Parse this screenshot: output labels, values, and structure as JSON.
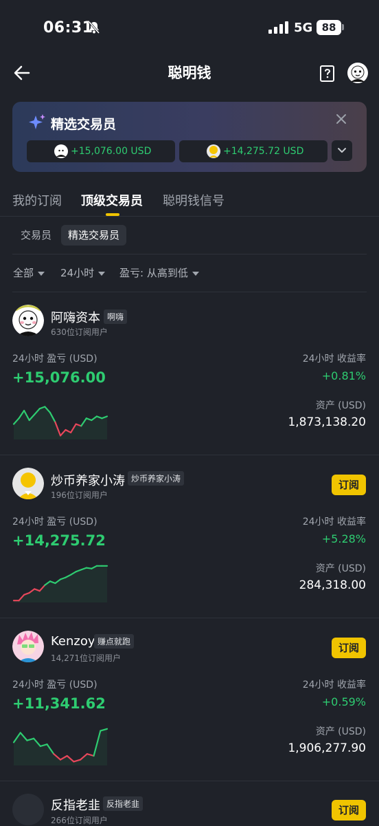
{
  "status_bar": {
    "time": "06:31",
    "network": "5G",
    "battery": "88"
  },
  "header": {
    "title": "聪明钱",
    "back_icon": "arrow-left-icon",
    "help_icon": "help-book-icon"
  },
  "banner": {
    "title": "精选交易员",
    "chips": [
      {
        "value": "+15,076.00 USD"
      },
      {
        "value": "+14,275.72 USD"
      }
    ]
  },
  "tabs": [
    "我的订阅",
    "顶级交易员",
    "聪明钱信号"
  ],
  "subtabs": [
    "交易员",
    "精选交易员"
  ],
  "filters": [
    "全部",
    "24小时",
    "盈亏: 从高到低"
  ],
  "labels": {
    "pnl": "24小时 盈亏 (USD)",
    "roi": "24小时 收益率",
    "assets": "资产 (USD)",
    "subscribe": "订阅"
  },
  "colors": {
    "accent": "#f0c400",
    "up": "#2ecc71",
    "down": "#e8475b",
    "bg": "#1f2229"
  },
  "traders": [
    {
      "name": "阿嗨资本",
      "tag": "啊嗨",
      "subscribers": "630位订阅用户",
      "pnl": "+15,076.00",
      "roi": "+0.81%",
      "assets": "1,873,138.20",
      "spark": [
        0.6,
        0.45,
        0.25,
        0.5,
        0.35,
        0.2,
        0.15,
        0.3,
        0.55,
        0.9,
        0.75,
        0.82,
        0.6,
        0.65,
        0.45,
        0.5,
        0.4,
        0.45,
        0.4
      ]
    },
    {
      "name": "炒币养家小涛",
      "tag": "炒币养家小涛",
      "subscribers": "196位订阅用户",
      "pnl": "+14,275.72",
      "roi": "+5.28%",
      "assets": "284,318.00",
      "spark": [
        0.95,
        0.95,
        0.8,
        0.75,
        0.65,
        0.7,
        0.55,
        0.45,
        0.5,
        0.4,
        0.35,
        0.28,
        0.2,
        0.15,
        0.1,
        0.12,
        0.05,
        0.05,
        0.05
      ]
    },
    {
      "name": "Kenzoy",
      "tag": "赚点就跑",
      "subscribers": "14,271位订阅用户",
      "pnl": "+11,341.62",
      "roi": "+0.59%",
      "assets": "1,906,277.90",
      "spark": [
        0.4,
        0.15,
        0.35,
        0.3,
        0.5,
        0.45,
        0.7,
        0.85,
        0.75,
        0.9,
        0.85,
        0.7,
        0.75,
        0.1,
        0.05
      ]
    },
    {
      "name": "反指老韭",
      "tag": "反指老韭",
      "subscribers": "266位订阅用户"
    }
  ]
}
